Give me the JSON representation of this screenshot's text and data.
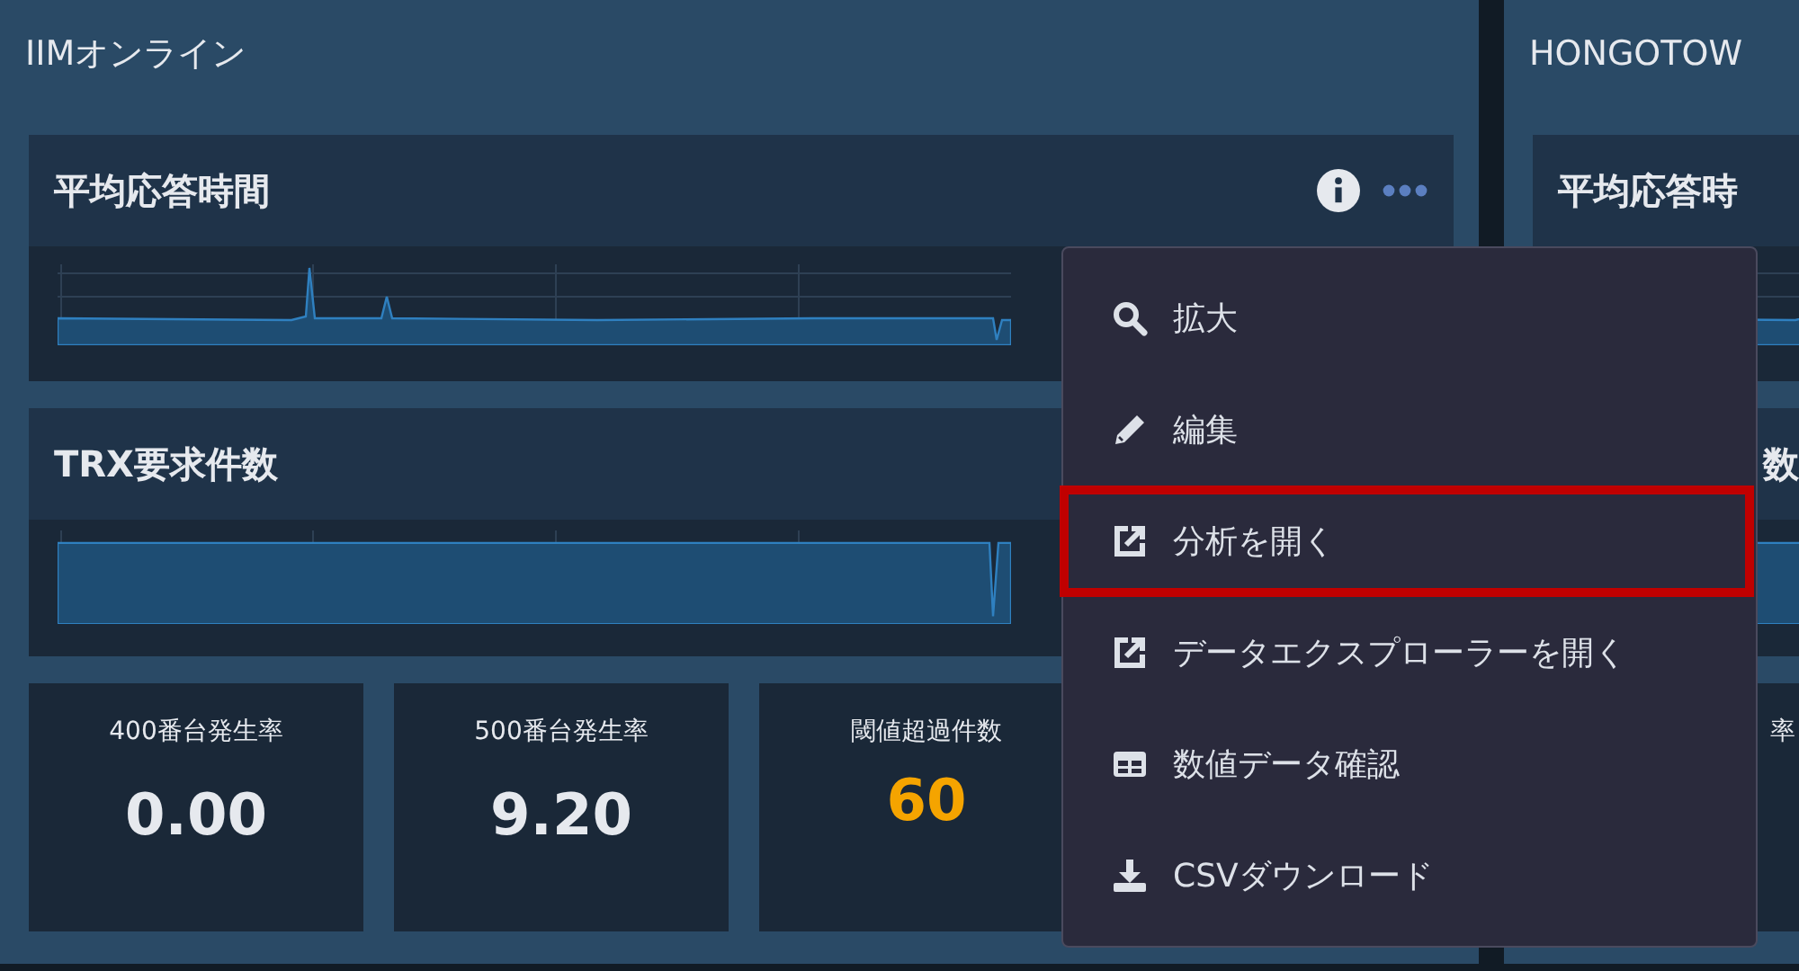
{
  "panels": [
    {
      "title": "IIMオンライン",
      "cards": [
        {
          "title": "平均応答時間",
          "kind": "spiky",
          "show_tools": true
        },
        {
          "title": "TRX要求件数",
          "kind": "flat"
        }
      ],
      "stats": [
        {
          "label": "400番台発生率",
          "value": "0.00",
          "alert": false
        },
        {
          "label": "500番台発生率",
          "value": "9.20",
          "alert": false
        },
        {
          "label": "閾値超過件数",
          "value": "60",
          "alert": true
        }
      ]
    },
    {
      "title": "HONGOTOW",
      "cards": [
        {
          "title": "平均応答時",
          "kind": "spiky"
        },
        {
          "title": "数",
          "kind": "flat"
        }
      ],
      "stats": [
        {
          "label": "率"
        }
      ]
    }
  ],
  "menu": {
    "items": [
      {
        "label": "拡大",
        "kind": "search",
        "highlighted": false
      },
      {
        "label": "編集",
        "kind": "edit",
        "highlighted": false
      },
      {
        "label": "分析を開く",
        "kind": "open",
        "highlighted": true
      },
      {
        "label": "データエクスプローラーを開く",
        "kind": "open",
        "highlighted": false
      },
      {
        "label": "数値データ確認",
        "kind": "table",
        "highlighted": false
      },
      {
        "label": "CSVダウンロード",
        "kind": "download",
        "highlighted": false
      }
    ]
  }
}
